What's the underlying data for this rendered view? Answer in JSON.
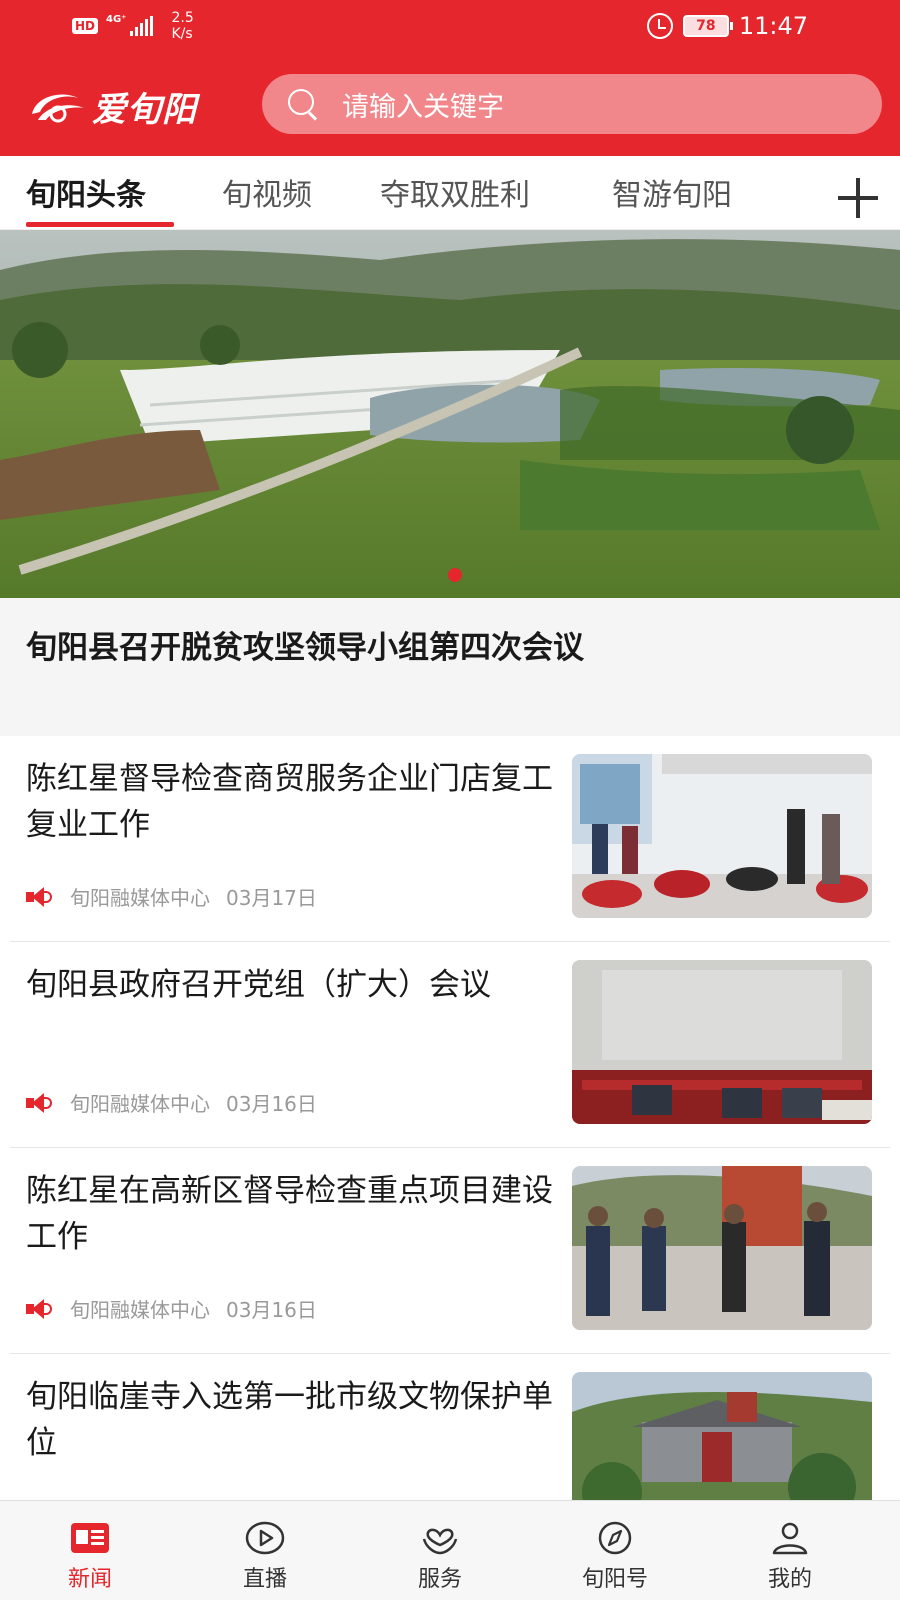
{
  "status_bar": {
    "hd": "HD",
    "network": "4G⁺",
    "speed_value": "2.5",
    "speed_unit": "K/s",
    "battery": "78",
    "time": "11:47"
  },
  "header": {
    "logo_text": "爱旬阳",
    "search_placeholder": "请输入关键字"
  },
  "tabs": [
    {
      "label": "旬阳头条",
      "active": true
    },
    {
      "label": "旬视频",
      "active": false
    },
    {
      "label": "夺取双胜利",
      "active": false
    },
    {
      "label": "智游旬阳",
      "active": false
    }
  ],
  "banner": {
    "caption": "旬阳县召开脱贫攻坚领导小组第四次会议"
  },
  "news": [
    {
      "title": "陈红星督导检查商贸服务企业门店复工复业工作",
      "source": "旬阳融媒体中心",
      "date": "03月17日"
    },
    {
      "title": "旬阳县政府召开党组（扩大）会议",
      "source": "旬阳融媒体中心",
      "date": "03月16日"
    },
    {
      "title": "陈红星在高新区督导检查重点项目建设工作",
      "source": "旬阳融媒体中心",
      "date": "03月16日"
    },
    {
      "title": "旬阳临崖寺入选第一批市级文物保护单位",
      "source": "",
      "date": ""
    }
  ],
  "bottom_nav": [
    {
      "label": "新闻",
      "icon": "news-icon",
      "active": true
    },
    {
      "label": "直播",
      "icon": "play-icon",
      "active": false
    },
    {
      "label": "服务",
      "icon": "service-heart-icon",
      "active": false
    },
    {
      "label": "旬阳号",
      "icon": "compass-icon",
      "active": false
    },
    {
      "label": "我的",
      "icon": "user-icon",
      "active": false
    }
  ],
  "colors": {
    "brand_red": "#e5262c",
    "text_dark": "#1a1a1a",
    "text_muted": "#999999"
  }
}
